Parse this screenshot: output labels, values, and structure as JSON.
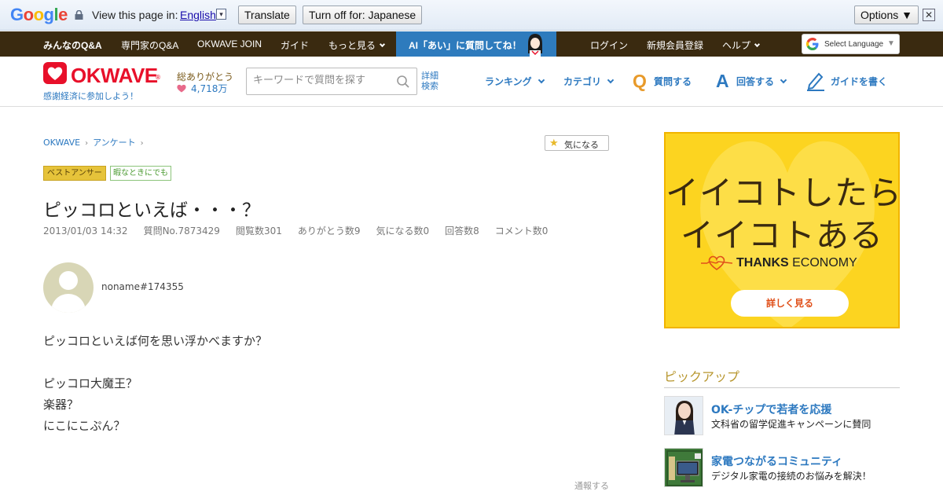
{
  "translate_bar": {
    "logo": "Google",
    "prompt": "View this page in:",
    "language": "English",
    "translate_btn": "Translate",
    "turnoff_btn": "Turn off for: Japanese",
    "options_btn": "Options ▼",
    "close": "✕"
  },
  "top_nav": {
    "items": [
      "みんなのQ&A",
      "専門家のQ&A",
      "OKWAVE JOIN",
      "ガイド",
      "もっと見る"
    ],
    "ai_banner": "AI「あい」に質問してね！",
    "right_items": [
      "ログイン",
      "新規会員登録",
      "ヘルプ"
    ],
    "select_language": "Select Language",
    "select_arrow": "▼"
  },
  "header": {
    "logo_text": "OKWAVE",
    "logo_reg": "®",
    "tagline": "感謝経済に参加しよう！",
    "thanks_label": "総ありがとう",
    "thanks_count": "4,718万",
    "search_placeholder": "キーワードで質問を探す",
    "advanced_search_1": "詳細",
    "advanced_search_2": "検索",
    "nav": {
      "ranking": "ランキング",
      "category": "カテゴリ",
      "ask": "質問する",
      "answer": "回答する",
      "guide": "ガイドを書く"
    }
  },
  "breadcrumb": [
    "OKWAVE",
    "アンケート"
  ],
  "kininaru_btn": "気になる",
  "badges": {
    "best_answer": "ベストアンサー",
    "category": "暇なときにでも"
  },
  "question": {
    "title": "ピッコロといえば・・・？",
    "meta": {
      "date": "2013/01/03 14:32",
      "qno": "質問No.7873429",
      "views": "閲覧数301",
      "thanks": "ありがとう数9",
      "kininaru": "気になる数0",
      "answers": "回答数8",
      "comments": "コメント数0"
    },
    "user": "noname#174355",
    "body": [
      "ピッコロといえば何を思い浮かべますか？",
      "",
      "ピッコロ大魔王？",
      "楽器？",
      "にこにこぷん？"
    ],
    "report": "通報する"
  },
  "ad": {
    "line1": "イイコトしたら",
    "line2": "イイコトある",
    "brand_bold": "THANKS",
    "brand_rest": " ECONOMY",
    "button": "詳しく見る",
    "colors": {
      "bg": "#fcd420",
      "text": "#3a2a10",
      "accent": "#e0501a"
    }
  },
  "pickup": {
    "heading": "ピックアップ",
    "items": [
      {
        "title": "OK-チップで若者を応援",
        "subtitle": "文科省の留学促進キャンペーンに賛同"
      },
      {
        "title": "家電つながるコミュニティ",
        "subtitle": "デジタル家電の接続のお悩みを解決！"
      }
    ]
  },
  "colors": {
    "brand_red": "#e8102a",
    "link_blue": "#2d79c0",
    "nav_dark": "#3a2a10",
    "best_badge": "#e6c33a"
  }
}
